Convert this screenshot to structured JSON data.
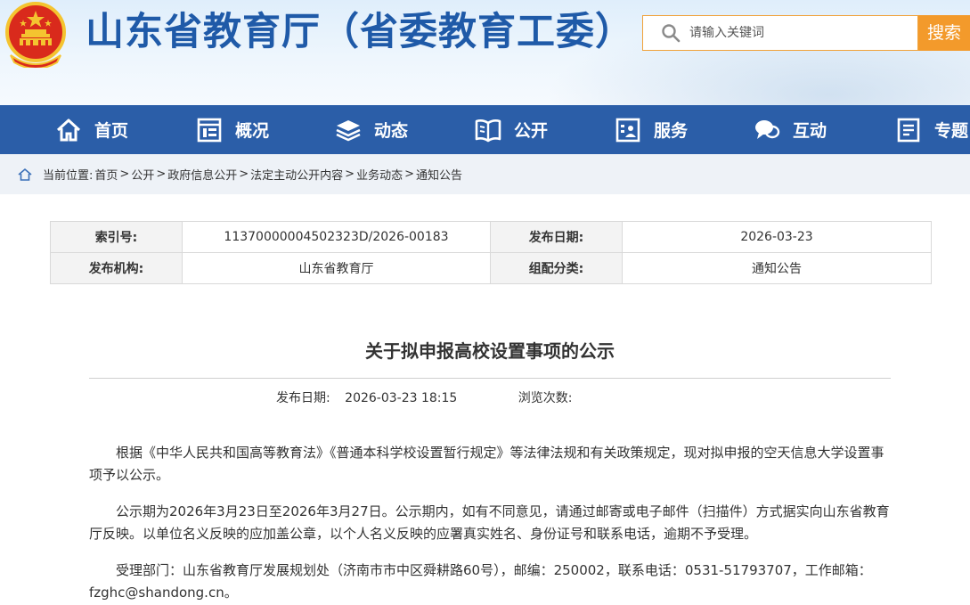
{
  "header": {
    "site_title": "山东省教育厅（省委教育工委）",
    "search_placeholder": "请输入关键词",
    "search_button": "搜索"
  },
  "nav": {
    "items": [
      {
        "label": "首页",
        "icon": "home-icon"
      },
      {
        "label": "概况",
        "icon": "building-icon"
      },
      {
        "label": "动态",
        "icon": "stack-icon"
      },
      {
        "label": "公开",
        "icon": "book-icon"
      },
      {
        "label": "服务",
        "icon": "service-icon"
      },
      {
        "label": "互动",
        "icon": "chat-icon"
      },
      {
        "label": "专题",
        "icon": "document-icon"
      }
    ]
  },
  "breadcrumb": {
    "prefix": "当前位置:",
    "items": [
      "首页",
      "公开",
      "政府信息公开",
      "法定主动公开内容",
      "业务动态",
      "通知公告"
    ]
  },
  "meta": {
    "index_label": "索引号:",
    "index_value": "11370000004502323D/2026-00183",
    "pub_date_label": "发布日期:",
    "pub_date_value": "2026-03-23",
    "org_label": "发布机构:",
    "org_value": "山东省教育厅",
    "category_label": "组配分类:",
    "category_value": "通知公告"
  },
  "article": {
    "title": "关于拟申报高校设置事项的公示",
    "date_label": "发布日期:",
    "date_value": "2026-03-23 18:15",
    "views_label": "浏览次数:",
    "paragraphs": [
      "根据《中华人民共和国高等教育法》《普通本科学校设置暂行规定》等法律法规和有关政策规定，现对拟申报的空天信息大学设置事项予以公示。",
      "公示期为2026年3月23日至2026年3月27日。公示期内，如有不同意见，请通过邮寄或电子邮件（扫描件）方式据实向山东省教育厅反映。以单位名义反映的应加盖公章，以个人名义反映的应署真实姓名、身份证号和联系电话，逾期不予受理。",
      "受理部门：山东省教育厅发展规划处（济南市市中区舜耕路60号），邮编：250002，联系电话：0531-51793707，工作邮箱：fzghc@shandong.cn。"
    ]
  },
  "colors": {
    "nav_bg": "#2b5ea8",
    "title_blue": "#1f5aa8",
    "search_orange": "#f39a2b"
  }
}
